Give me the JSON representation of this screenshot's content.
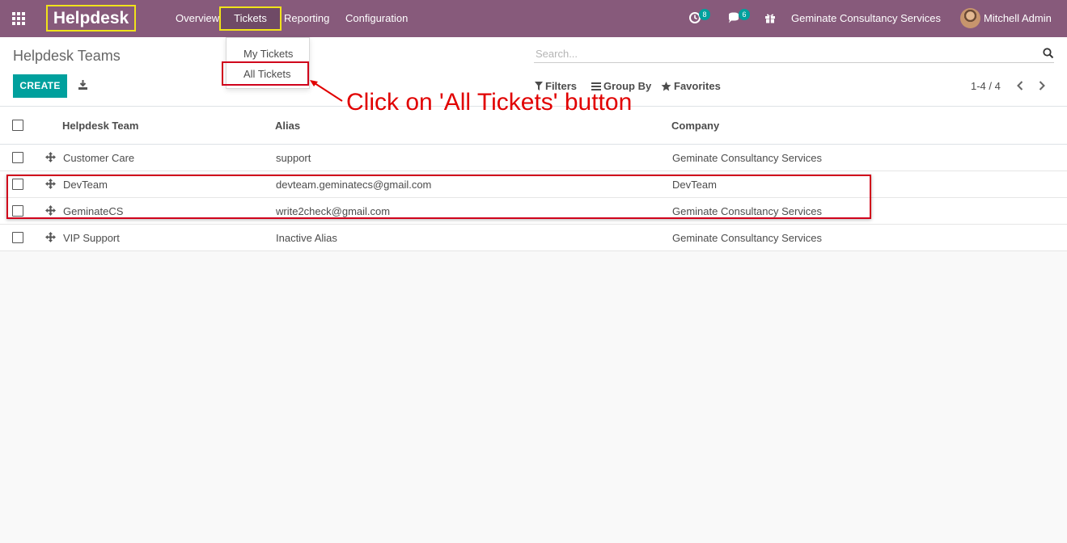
{
  "navbar": {
    "brand": "Helpdesk",
    "menu": [
      "Overview",
      "Tickets",
      "Reporting",
      "Configuration"
    ],
    "activity_count": "8",
    "message_count": "6",
    "company": "Geminate Consultancy Services",
    "user": "Mitchell Admin",
    "bg_color": "#875a7b"
  },
  "dropdown": {
    "items": [
      "My Tickets",
      "All Tickets"
    ]
  },
  "control_panel": {
    "title": "Helpdesk Teams",
    "create_label": "CREATE",
    "search_placeholder": "Search...",
    "filters_label": "Filters",
    "group_by_label": "Group By",
    "favorites_label": "Favorites",
    "pager": "1-4 / 4"
  },
  "annotation": {
    "text": "Click on 'All Tickets' button",
    "color": "#e10000"
  },
  "list": {
    "columns": [
      "Helpdesk Team",
      "Alias",
      "Company"
    ],
    "rows": [
      {
        "team": "Customer Care",
        "alias": "support",
        "company": "Geminate Consultancy Services"
      },
      {
        "team": "DevTeam",
        "alias": "devteam.geminatecs@gmail.com",
        "company": "DevTeam"
      },
      {
        "team": "GeminateCS",
        "alias": "write2check@gmail.com",
        "company": "Geminate Consultancy Services"
      },
      {
        "team": "VIP Support",
        "alias": "Inactive Alias",
        "company": "Geminate Consultancy Services"
      }
    ]
  },
  "icons": {
    "apps": "apps-grid-icon",
    "activity": "clock-icon",
    "messages": "chat-icon",
    "gift": "gift-icon",
    "download": "download-icon",
    "search": "search-icon",
    "filter": "filter-icon",
    "group_by": "bars-icon",
    "favorites": "star-icon",
    "drag": "drag-handle-icon"
  },
  "colors": {
    "primary": "#00a09d",
    "highlight_yellow": "#f0e21a",
    "highlight_red": "#d0021b"
  }
}
